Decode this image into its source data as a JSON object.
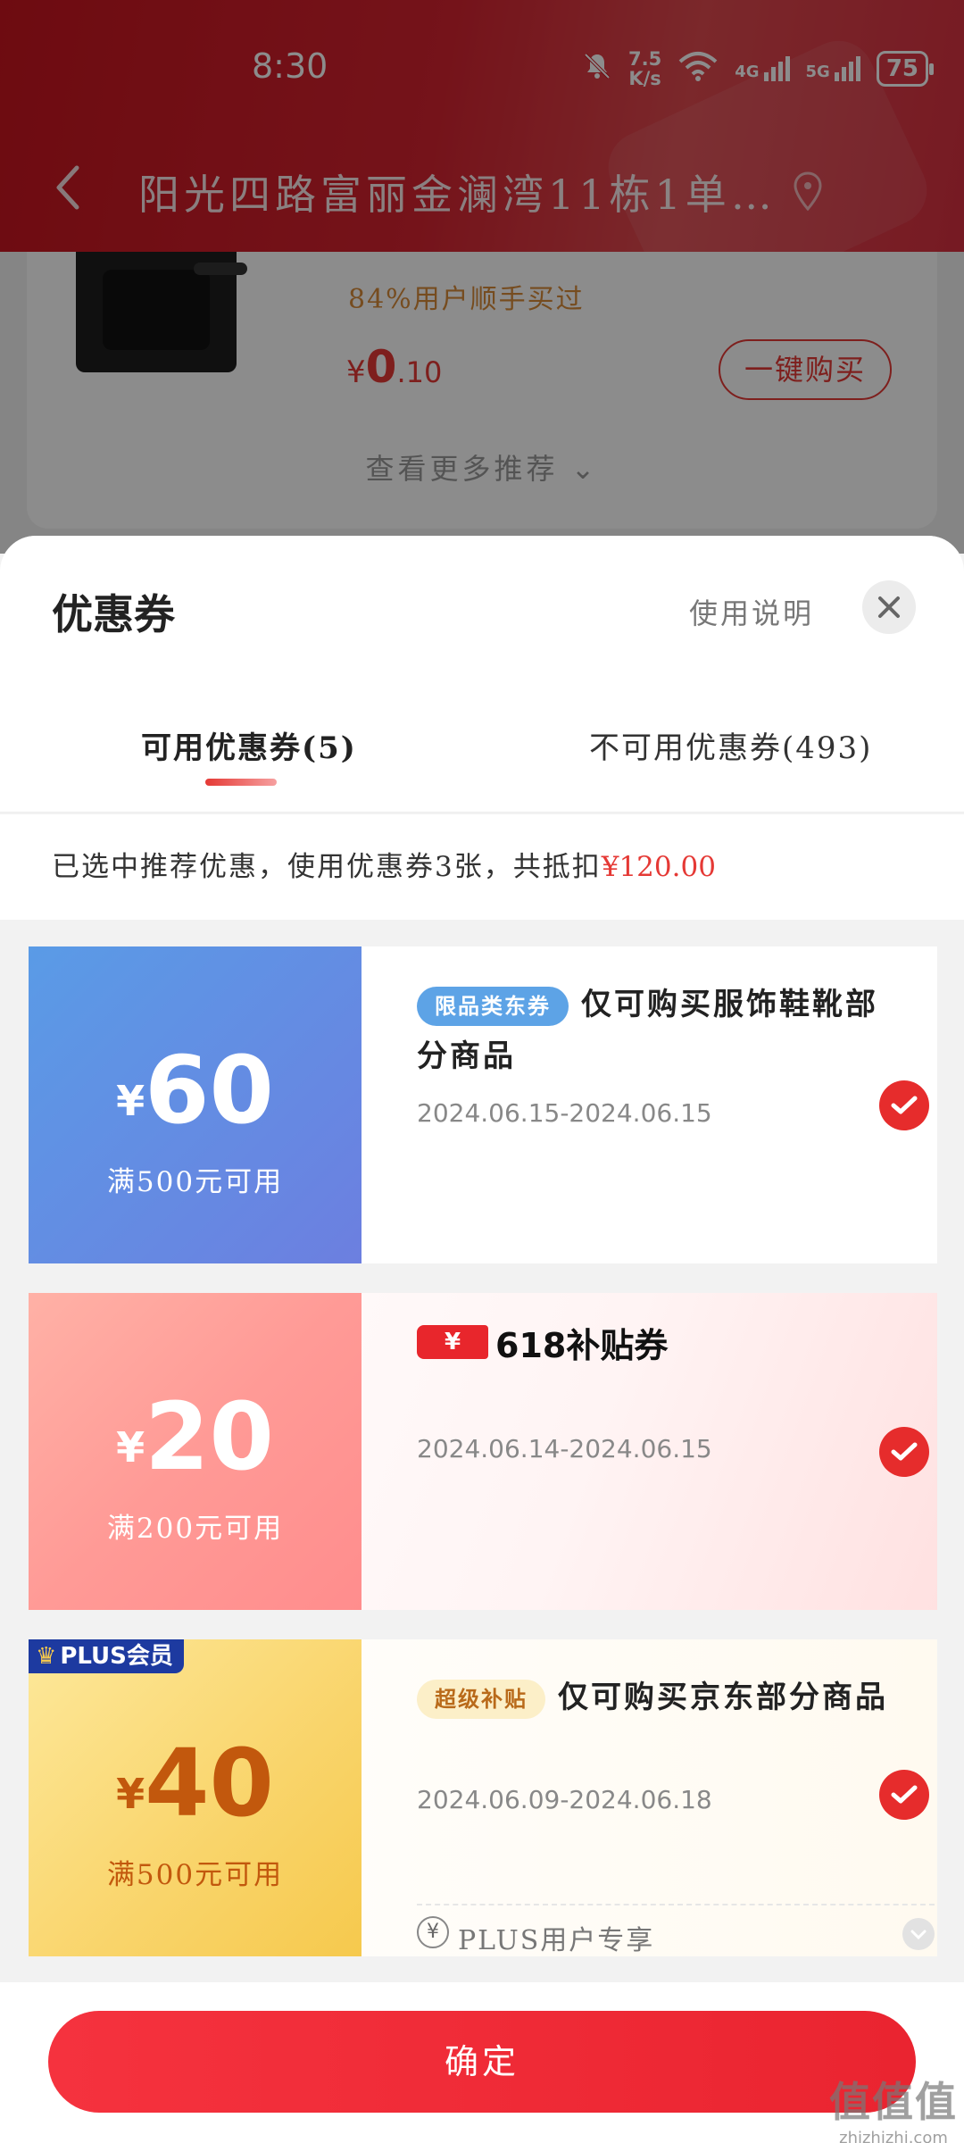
{
  "status_bar": {
    "time": "8:30",
    "net_speed_value": "7.5",
    "net_speed_unit": "K/s",
    "signal1_label": "4G",
    "signal2_label": "5G",
    "battery": "75"
  },
  "header": {
    "address": "阳光四路富丽金澜湾11栋1单…"
  },
  "product": {
    "bought_text": "84%用户顺手买过",
    "price_currency": "¥",
    "price_int": "0",
    "price_dec": ".10",
    "buy_button": "一键购买",
    "more_recommend": "查看更多推荐 ⌄"
  },
  "sheet": {
    "title": "优惠券",
    "usage_link": "使用说明",
    "tabs": [
      {
        "label": "可用优惠券(5)"
      },
      {
        "label": "不可用优惠券(493)"
      }
    ],
    "summary_text": "已选中推荐优惠，使用优惠券3张，共抵扣",
    "summary_amount": "¥120.00"
  },
  "coupons": [
    {
      "currency": "¥",
      "amount": "60",
      "condition": "满500元可用",
      "tag": "限品类东券",
      "title": "仅可购买服饰鞋靴部分商品",
      "dates": "2024.06.15-2024.06.15",
      "selected": true
    },
    {
      "currency": "¥",
      "amount": "20",
      "condition": "满200元可用",
      "badge_symbol": "¥",
      "badge_text": "618补贴券",
      "dates": "2024.06.14-2024.06.15",
      "selected": true
    },
    {
      "corner_badge": "PLUS会员",
      "currency": "¥",
      "amount": "40",
      "condition": "满500元可用",
      "tag": "超级补贴",
      "title": "仅可购买京东部分商品",
      "dates": "2024.06.09-2024.06.18",
      "footer_icon": "¥",
      "footer_text": "PLUS用户专享",
      "selected": true
    }
  ],
  "confirm_button": "确定",
  "watermark": {
    "line1": "值值值",
    "line2": "zhizhizhi.com"
  },
  "colors": {
    "accent_red": "#e53935",
    "header_red": "#c8151f",
    "coupon1_blue": "#5a9be6",
    "coupon2_pink": "#ff9a96",
    "coupon3_gold": "#f6c94d"
  }
}
